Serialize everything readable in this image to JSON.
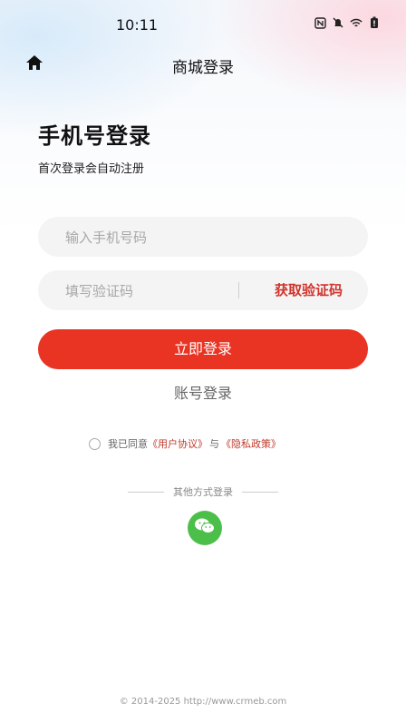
{
  "status_bar": {
    "time": "10:11",
    "icons": [
      "nfc-icon",
      "mute-icon",
      "wifi-icon",
      "battery-icon"
    ]
  },
  "header": {
    "title": "商城登录",
    "home_icon": "home-icon"
  },
  "login": {
    "title": "手机号登录",
    "subtitle": "首次登录会自动注册",
    "phone_placeholder": "输入手机号码",
    "code_placeholder": "填写验证码",
    "get_code_label": "获取验证码",
    "submit_label": "立即登录",
    "account_login_label": "账号登录"
  },
  "agreement": {
    "prefix": "我已同意",
    "user_agreement": "《用户协议》",
    "and": "与",
    "privacy_policy": "《隐私政策》"
  },
  "other_login": {
    "label": "其他方式登录",
    "wechat_icon": "wechat-icon"
  },
  "footer": {
    "copyright": "© 2014-2025 http://www.crmeb.com"
  },
  "colors": {
    "accent": "#e93323",
    "wechat": "#4cbf4a",
    "link": "#c03a2b"
  }
}
